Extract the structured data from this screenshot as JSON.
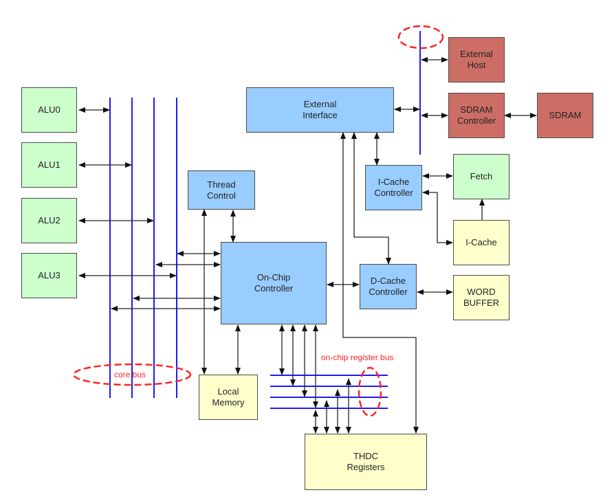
{
  "diagram": {
    "blocks": {
      "alu0": "ALU0",
      "alu1": "ALU1",
      "alu2": "ALU2",
      "alu3": "ALU3",
      "external_interface": "External\nInterface",
      "external_host": "External\nHost",
      "sdram_controller": "SDRAM\nController",
      "sdram": "SDRAM",
      "thread_control": "Thread\nControl",
      "icache_controller": "I-Cache\nController",
      "fetch": "Fetch",
      "icache": "I-Cache",
      "onchip_controller": "On-Chip\nController",
      "dcache_controller": "D-Cache\nController",
      "word_buffer": "WORD\nBUFFER",
      "local_memory": "Local\nMemory",
      "thdc_registers": "THDC\nRegisters"
    },
    "annotations": {
      "core_bus": "core bus",
      "register_bus": "on-chip register bus"
    },
    "colors": {
      "alu_fill": "#ccffcc",
      "controller_fill": "#99ccff",
      "external_fill": "#cc6e66",
      "memory_fill": "#ffffcc",
      "bus_line": "#0000ff",
      "annotation": "#ff2222"
    }
  }
}
